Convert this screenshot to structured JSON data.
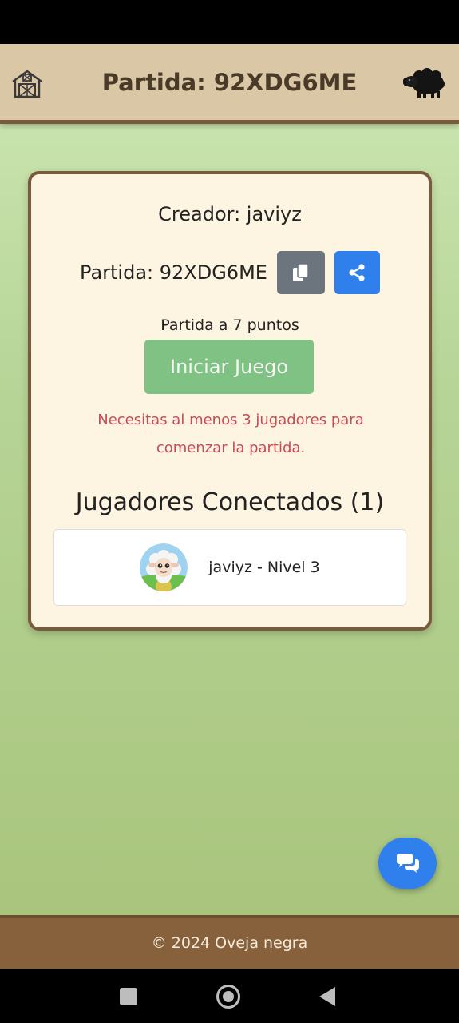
{
  "header": {
    "title": "Partida: 92XDG6ME",
    "home_icon": "barn-icon",
    "logo_icon": "black-sheep-icon"
  },
  "card": {
    "creator": "Creador: javiyz",
    "code_label": "Partida: 92XDG6ME",
    "copy_icon": "copy-icon",
    "share_icon": "share-icon",
    "points": "Partida a 7 puntos",
    "start_button": "Iniciar Juego",
    "warning": "Necesitas al menos 3 jugadores para comenzar la partida.",
    "players_title": "Jugadores Conectados (1)",
    "players": [
      {
        "name": "javiyz - Nivel 3",
        "avatar": "sheep-avatar"
      }
    ]
  },
  "chat_icon": "chat-icon",
  "footer": {
    "text": "© 2024 Oveja negra"
  },
  "colors": {
    "header_bg": "#d9c7a5",
    "card_bg": "#fdf5e1",
    "card_border": "#7a5a3c",
    "primary": "#2f80ec",
    "secondary": "#6c757d",
    "success_disabled": "#7fc283",
    "danger_text": "#c94a57",
    "footer_bg": "#87603c"
  }
}
